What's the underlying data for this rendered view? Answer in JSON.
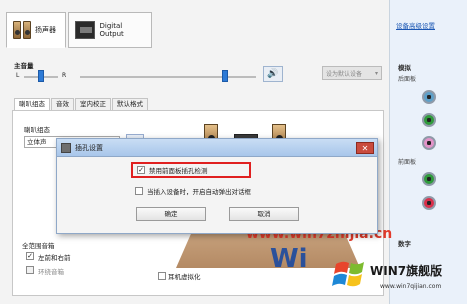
{
  "window": {
    "device_tabs": [
      {
        "label": "扬声器",
        "icon": "speaker-icon",
        "active": true
      },
      {
        "label": "Digital Output",
        "icon": "digital-output-icon",
        "active": false
      }
    ]
  },
  "volume": {
    "label": "主音量",
    "left": "L",
    "right": "R",
    "mute_icon": "speaker-volume-icon",
    "default_device_select": "设为默认设备"
  },
  "subtabs": [
    "喇叭组态",
    "音效",
    "室内校正",
    "默认格式"
  ],
  "config": {
    "label": "喇叭组态",
    "selected": "立体声"
  },
  "full_range": {
    "label": "全范围音箱",
    "options": [
      {
        "label": "左前和右前",
        "checked": true
      },
      {
        "label": "环绕音箱",
        "checked": false
      }
    ]
  },
  "headphone_virtualization": {
    "label": "耳机虚拟化",
    "checked": false
  },
  "right_panel": {
    "link": "设备高级设置",
    "analog_heading": "模拟",
    "back_panel": "后面板",
    "front_panel": "前面板",
    "digital_heading": "数字",
    "jack_colors": [
      "#5ea0c9",
      "#2f9a3b",
      "#e293c8",
      "#2f9a3b",
      "#d9304b"
    ]
  },
  "popup": {
    "title": "插孔设置",
    "close": "✕",
    "option1": {
      "label": "禁用前面板插孔检测",
      "checked": true
    },
    "option2": {
      "label": "当插入设备时，开启自动弹出对话框",
      "checked": false
    },
    "ok": "确定",
    "cancel": "取消"
  },
  "watermark": {
    "url": "www.win7zhijia.cn",
    "brand": "WIN7旗舰版",
    "brand_url": "www.win7qijian.com",
    "big_text": "Wi"
  }
}
